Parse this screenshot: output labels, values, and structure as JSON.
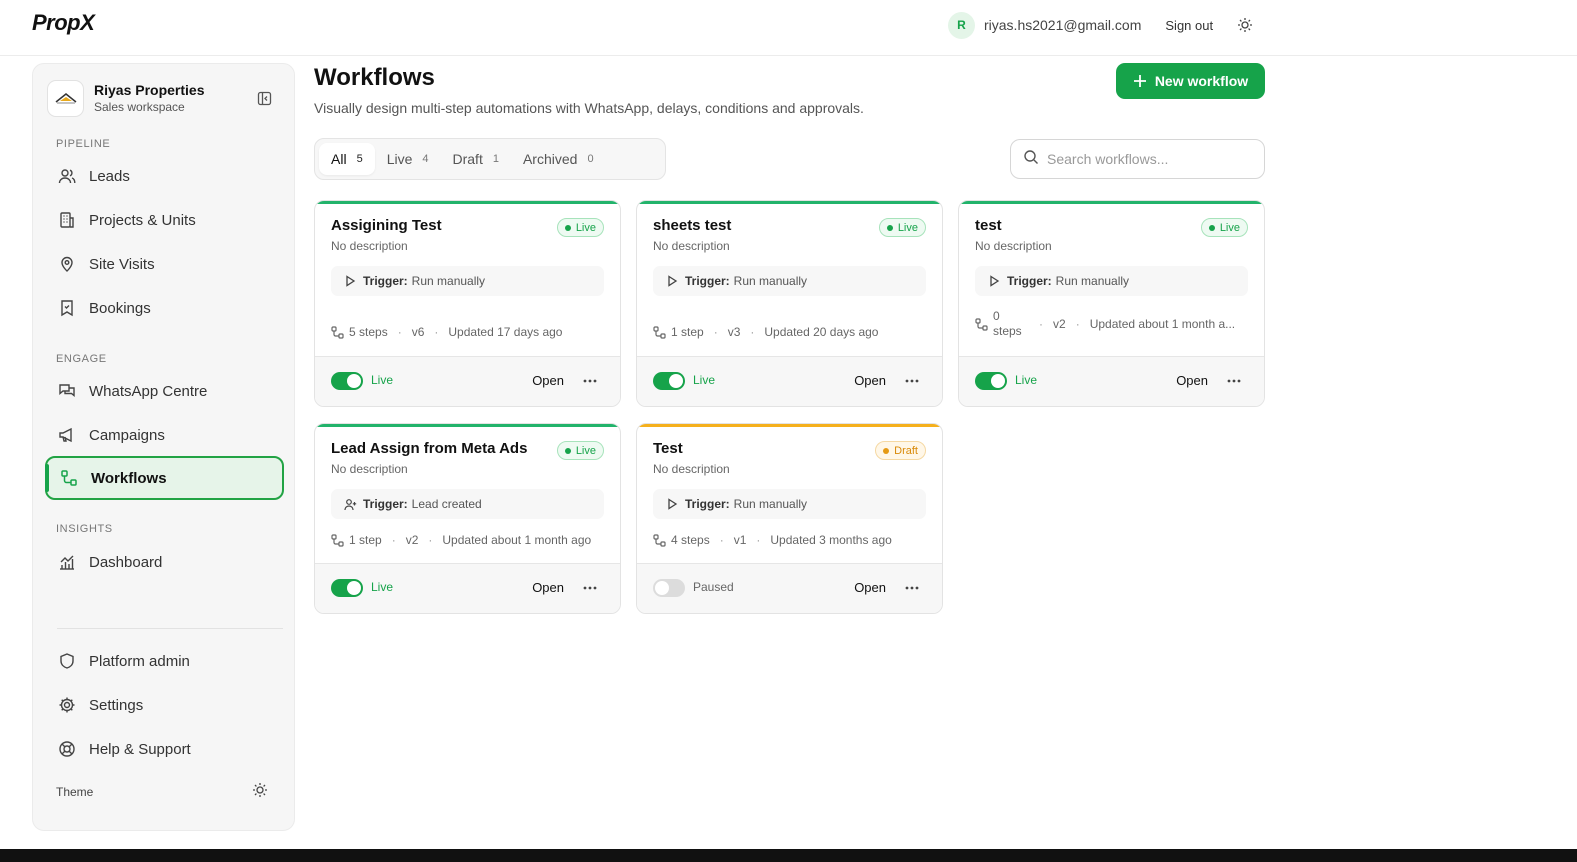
{
  "app": {
    "brand": "PropX"
  },
  "header": {
    "avatar_initial": "R",
    "email": "riyas.hs2021@gmail.com",
    "signout_label": "Sign out"
  },
  "workspace": {
    "name": "Riyas Properties",
    "subtitle": "Sales workspace"
  },
  "sidebar": {
    "pipeline_label": "PIPELINE",
    "engage_label": "ENGAGE",
    "insights_label": "INSIGHTS",
    "items": {
      "leads": "Leads",
      "projects": "Projects & Units",
      "site_visits": "Site Visits",
      "bookings": "Bookings",
      "whatsapp": "WhatsApp Centre",
      "campaigns": "Campaigns",
      "workflows": "Workflows",
      "dashboard": "Dashboard",
      "platform_admin": "Platform admin",
      "settings": "Settings",
      "help": "Help & Support"
    },
    "theme_label": "Theme"
  },
  "page": {
    "title": "Workflows",
    "subtitle": "Visually design multi-step automations with WhatsApp, delays, conditions and approvals.",
    "new_button": "New workflow"
  },
  "tabs": [
    {
      "label": "All",
      "count": "5"
    },
    {
      "label": "Live",
      "count": "4"
    },
    {
      "label": "Draft",
      "count": "1"
    },
    {
      "label": "Archived",
      "count": "0"
    }
  ],
  "search": {
    "placeholder": "Search workflows..."
  },
  "colors": {
    "accent": "#16a34a",
    "live_line": "#22b36b",
    "draft_line": "#f5b01d"
  },
  "cards": [
    {
      "title": "Assigining Test",
      "desc": "No description",
      "badge": "Live",
      "trigger_label": "Trigger:",
      "trigger": "Run manually",
      "trigger_icon": "play-icon",
      "steps": "5 steps",
      "version": "v6",
      "updated": "Updated 17 days ago",
      "toggle": "Live",
      "open": "Open"
    },
    {
      "title": "sheets test",
      "desc": "No description",
      "badge": "Live",
      "trigger_label": "Trigger:",
      "trigger": "Run manually",
      "trigger_icon": "play-icon",
      "steps": "1 step",
      "version": "v3",
      "updated": "Updated 20 days ago",
      "toggle": "Live",
      "open": "Open"
    },
    {
      "title": "test",
      "desc": "No description",
      "badge": "Live",
      "trigger_label": "Trigger:",
      "trigger": "Run manually",
      "trigger_icon": "play-icon",
      "steps": "0 steps",
      "version": "v2",
      "updated": "Updated about 1 month a...",
      "toggle": "Live",
      "open": "Open"
    },
    {
      "title": "Lead Assign from Meta Ads",
      "desc": "No description",
      "badge": "Live",
      "trigger_label": "Trigger:",
      "trigger": "Lead created",
      "trigger_icon": "user-plus-icon",
      "steps": "1 step",
      "version": "v2",
      "updated": "Updated about 1 month ago",
      "toggle": "Live",
      "open": "Open"
    },
    {
      "title": "Test",
      "desc": "No description",
      "badge": "Draft",
      "trigger_label": "Trigger:",
      "trigger": "Run manually",
      "trigger_icon": "play-icon",
      "steps": "4 steps",
      "version": "v1",
      "updated": "Updated 3 months ago",
      "toggle": "Paused",
      "open": "Open"
    }
  ]
}
